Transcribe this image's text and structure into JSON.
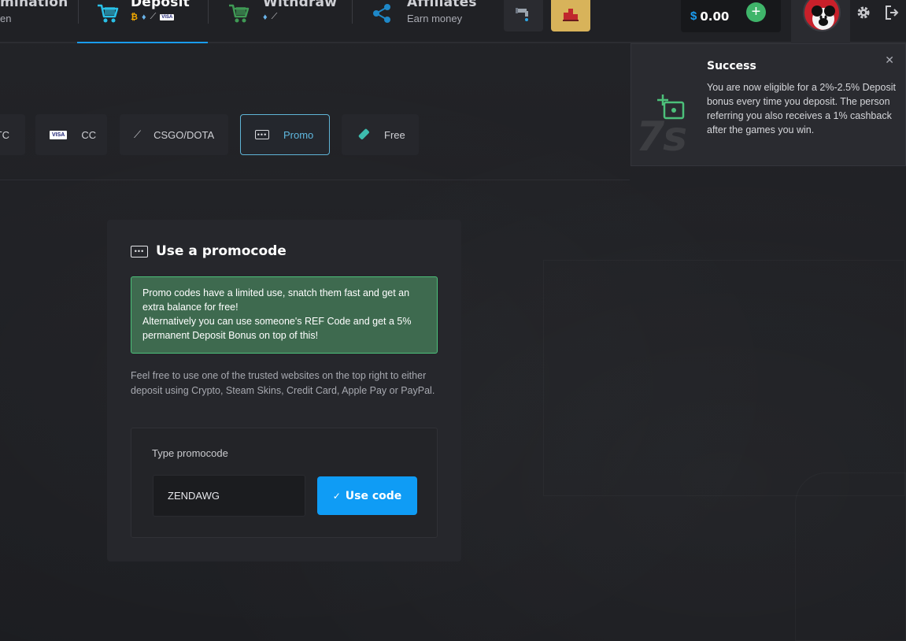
{
  "nav": {
    "items": [
      {
        "title": "mination",
        "sub": "en"
      },
      {
        "title": "Deposit",
        "sub": ""
      },
      {
        "title": "Withdraw",
        "sub": ""
      },
      {
        "title": "Affiliates",
        "sub": "Earn money"
      }
    ],
    "deposit_methods_icons": [
      "bitcoin-icon",
      "ethereum-icon",
      "knife-icon",
      "visa-icon"
    ],
    "withdraw_methods_icons": [
      "ethereum-icon",
      "knife-icon"
    ],
    "balance": {
      "currency": "$",
      "amount": "0.00"
    },
    "accent": "#1a9cf0"
  },
  "methods": [
    {
      "label": "TC",
      "icon": "bitcoin-icon"
    },
    {
      "label": "CC",
      "icon": "visa-icon",
      "badge": "VISA"
    },
    {
      "label": "CSGO/DOTA",
      "icon": "knife-icon"
    },
    {
      "label": "Promo",
      "icon": "promo-icon",
      "active": true
    },
    {
      "label": "Free",
      "icon": "ticket-icon"
    }
  ],
  "promo_card": {
    "title": "Use a promocode",
    "alert": {
      "line1": "Promo codes have a limited use, snatch them fast and get an extra balance for free!",
      "line2": "Alternatively you can use someone's REF Code and get a 5% permanent Deposit Bonus on top of this!"
    },
    "info": "Feel free to use one of the trusted websites on the top right to either deposit using Crypto, Steam Skins, Credit Card, Apple Pay or PayPal.",
    "input_label": "Type promocode",
    "input_value": "ZENDAWG",
    "button_label": "Use code"
  },
  "toast": {
    "title": "Success",
    "message": "You are now eligible for a 2%-2.5% Deposit bonus every time you deposit. The person referring you also receives a 1% cashback after the games you win.",
    "timer": "7s",
    "close": "✕"
  },
  "colors": {
    "success_bg": "#3e6a4f",
    "success_border": "#4cc07a",
    "primary_button": "#0f9cf5",
    "active_tab_border": "#5fb4d6"
  }
}
